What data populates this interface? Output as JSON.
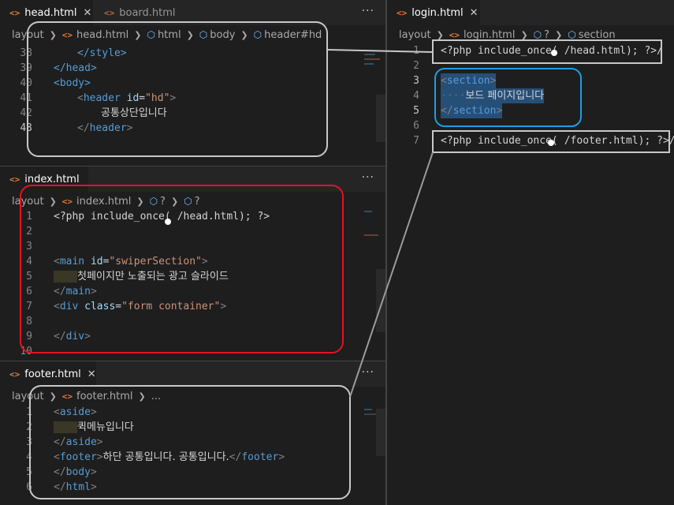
{
  "icons": {
    "html_file": "html-file-icon",
    "close": "close-icon",
    "more": "more-actions-icon",
    "chevron": "chevron-right-icon",
    "symbol": "symbol-cube-icon"
  },
  "colors": {
    "annotation_gray": "#c8c8c8",
    "annotation_red": "#e81123",
    "annotation_blue": "#1c9ee6",
    "selection": "#264f78"
  },
  "glyphs": {
    "html_icon": "<>",
    "close": "✕",
    "more": "···",
    "sep": "❯",
    "cube": "⬡"
  },
  "head_pane": {
    "tabs": [
      {
        "label": "head.html"
      },
      {
        "label": "board.html"
      }
    ],
    "breadcrumbs": [
      "layout",
      "head.html",
      "html",
      "body",
      "header#hd"
    ],
    "lines": [
      {
        "n": "38",
        "text": "</style>"
      },
      {
        "n": "39",
        "text": "</head>"
      },
      {
        "n": "40",
        "text": "<body>"
      },
      {
        "n": "41",
        "text": "<header id=\"hd\">"
      },
      {
        "n": "42",
        "text": "공통상단입니다"
      },
      {
        "n": "43",
        "text": "</header>"
      }
    ],
    "tokens": {
      "style_close": "</style>",
      "head_close": "</head>",
      "body_open": "<body>",
      "header_tag": "header",
      "id_attr": "id",
      "id_val": "\"hd\"",
      "header_close": "header",
      "korean": "공통상단입니다"
    }
  },
  "index_pane": {
    "tabs": [
      {
        "label": "index.html"
      }
    ],
    "breadcrumbs": [
      "layout",
      "index.html",
      "?",
      "?"
    ],
    "lines": [
      {
        "n": "1"
      },
      {
        "n": "2"
      },
      {
        "n": "3"
      },
      {
        "n": "4"
      },
      {
        "n": "5"
      },
      {
        "n": "6"
      },
      {
        "n": "7"
      },
      {
        "n": "8"
      },
      {
        "n": "9"
      },
      {
        "n": "10"
      }
    ],
    "tokens": {
      "php_a": "<?php include_once(",
      "php_b": "/head.html); ?>",
      "main_tag": "main",
      "id_attr": "id",
      "id_val": "\"swiperSection\"",
      "korean": "첫페이지만 노출되는 광고 슬라이드",
      "div_tag": "div",
      "class_attr": "class",
      "class_val": "\"form container\""
    }
  },
  "footer_pane": {
    "tabs": [
      {
        "label": "footer.html"
      }
    ],
    "breadcrumbs": [
      "layout",
      "footer.html",
      "..."
    ],
    "lines": [
      {
        "n": "1"
      },
      {
        "n": "2"
      },
      {
        "n": "3"
      },
      {
        "n": "4"
      },
      {
        "n": "5"
      },
      {
        "n": "6"
      }
    ],
    "tokens": {
      "aside_tag": "aside",
      "korean_menu": "퀵메뉴입니다",
      "footer_tag": "footer",
      "footer_text": "하단 공통입니다. 공통입니다.",
      "body_tag": "body",
      "html_tag": "html"
    }
  },
  "login_pane": {
    "tabs": [
      {
        "label": "login.html"
      }
    ],
    "breadcrumbs": [
      "layout",
      "login.html",
      "?",
      "section"
    ],
    "lines": [
      {
        "n": "1"
      },
      {
        "n": "2"
      },
      {
        "n": "3"
      },
      {
        "n": "4"
      },
      {
        "n": "5"
      },
      {
        "n": "6"
      },
      {
        "n": "7"
      }
    ],
    "tokens": {
      "php_a": "<?php include_once(",
      "php_head_b": "/head.html); ?>/",
      "section_tag": "section",
      "dots": "····",
      "korean": "보드 페이지입니다",
      "php_footer_b": "/footer.html); ?>/"
    }
  }
}
